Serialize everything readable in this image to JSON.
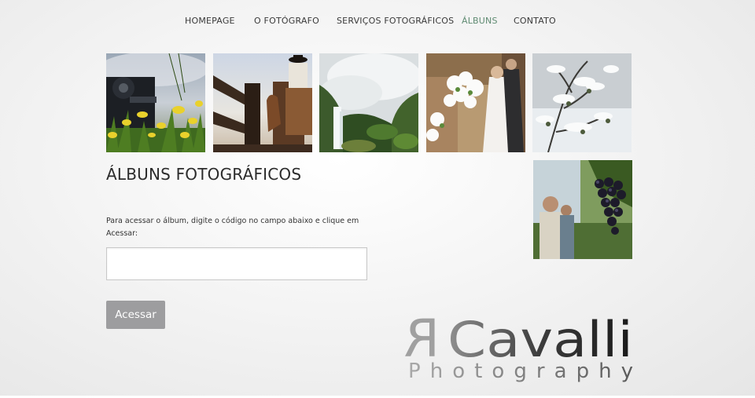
{
  "nav": {
    "items": [
      {
        "label": "HOMEPAGE",
        "active": false
      },
      {
        "label": "O FOTÓGRAFO",
        "active": false
      },
      {
        "label": "SERVIÇOS FOTOGRÁFICOS",
        "active": false
      },
      {
        "label": "ÁLBUNS",
        "active": true
      },
      {
        "label": "CONTATO",
        "active": false
      }
    ],
    "active_color": "#5f8b72"
  },
  "gallery": {
    "photos": [
      {
        "subject": "steam locomotive with yellow lilies"
      },
      {
        "subject": "gaucho on horseback by wooden fence"
      },
      {
        "subject": "waterfall in misty green valley"
      },
      {
        "subject": "wedding couple with flowers at church"
      },
      {
        "subject": "snow covered tree branches"
      },
      {
        "subject": "grapes on vine with vineyard workers"
      }
    ]
  },
  "main": {
    "title": "ÁLBUNS FOTOGRÁFICOS",
    "instructions": "Para acessar o álbum, digite o código no campo abaixo e clique em Acessar:",
    "code_input": {
      "value": "",
      "placeholder": ""
    },
    "submit_label": "Acessar",
    "button_color": "#9d9d9f"
  },
  "logo": {
    "mark": "R",
    "name": "Cavalli",
    "tagline": "Photography"
  }
}
